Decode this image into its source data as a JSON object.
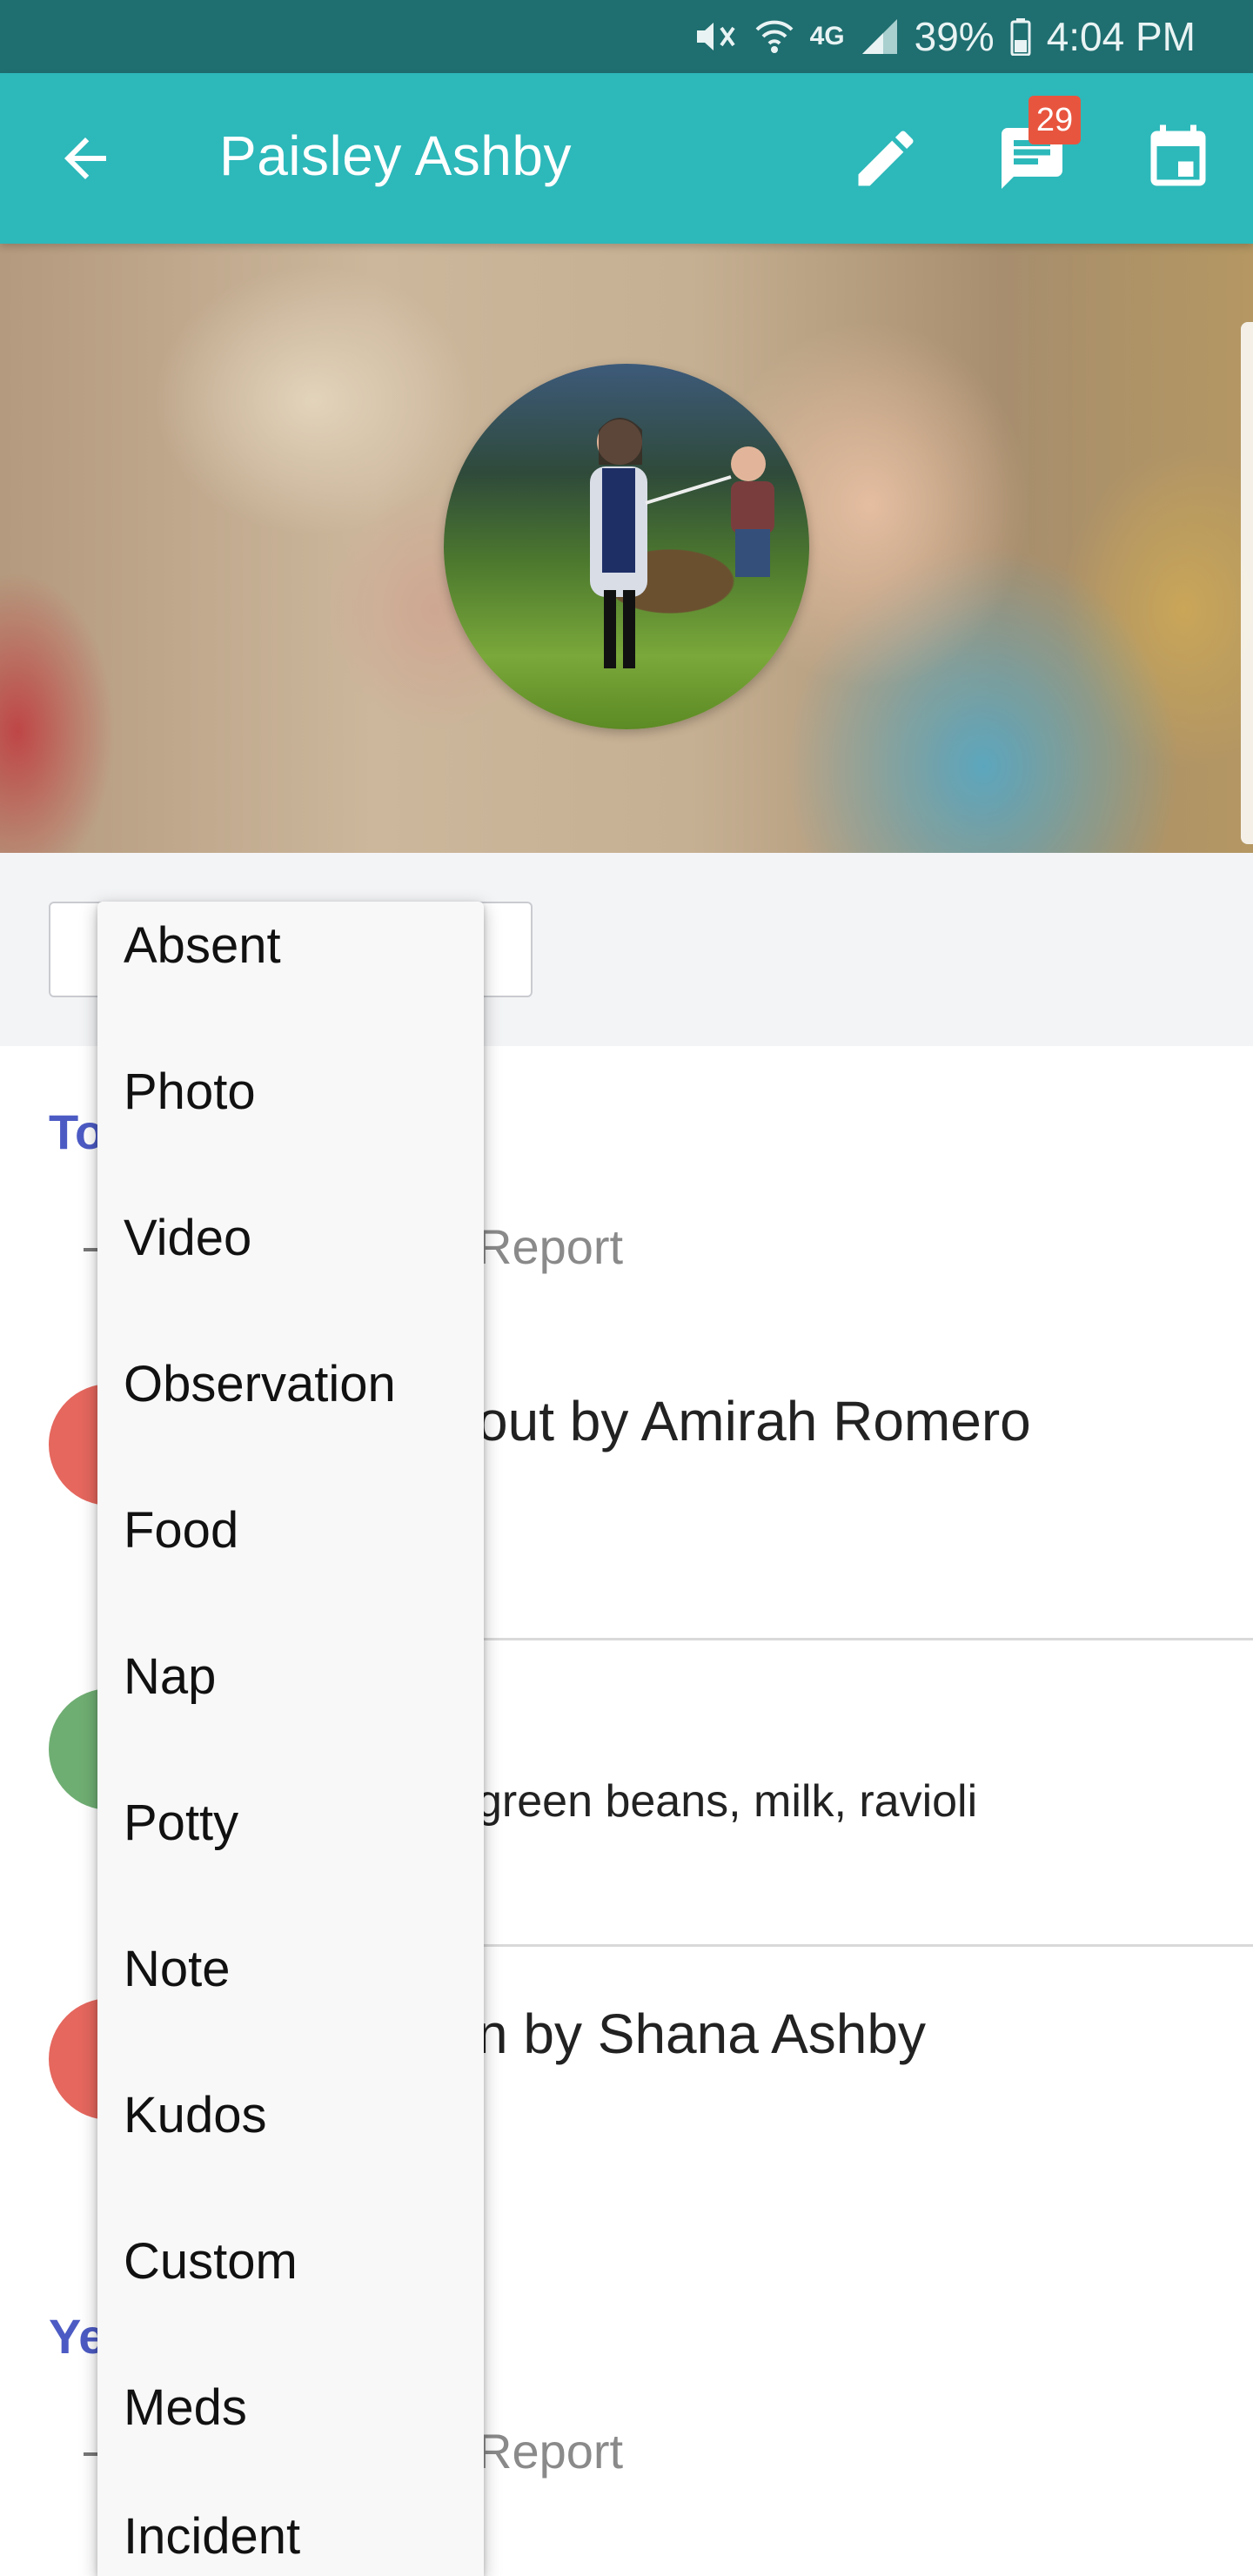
{
  "status_bar": {
    "battery": "39%",
    "time": "4:04 PM",
    "network": "4G"
  },
  "app_bar": {
    "title": "Paisley Ashby",
    "messages_badge": "29"
  },
  "icons": {
    "back": "arrow-back-icon",
    "edit": "pencil-icon",
    "messages": "chat-icon",
    "calendar": "calendar-icon"
  },
  "colors": {
    "status_bar": "#1f6e70",
    "app_bar": "#2db8ba",
    "badge": "#e8553e",
    "section_heading": "#4c5bc4"
  },
  "feed": {
    "today_heading": "To",
    "yesterday_heading": "Ye",
    "report_label_1": "Report",
    "row1_text": "out by Amirah Romero",
    "row2_text": "green beans, milk, ravioli",
    "row3_text": "n by Shana Ashby",
    "report_label_2": "Report"
  },
  "menu": {
    "items": [
      "Absent",
      "Photo",
      "Video",
      "Observation",
      "Food",
      "Nap",
      "Potty",
      "Note",
      "Kudos",
      "Custom",
      "Meds",
      "Incident"
    ]
  }
}
